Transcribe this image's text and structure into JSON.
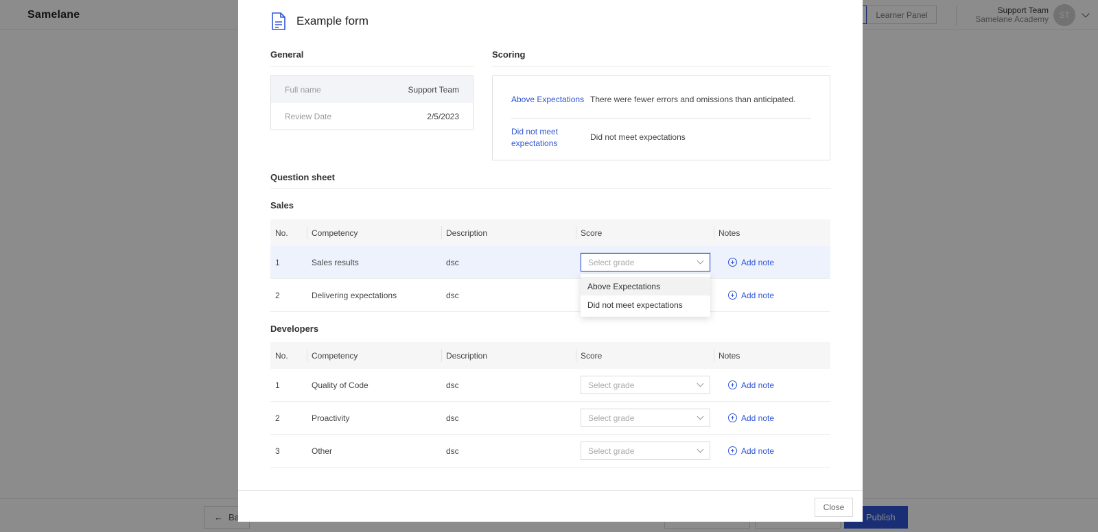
{
  "app": {
    "logo": "Samelane",
    "panel_active_fragment": "el",
    "panel_secondary": "Learner Panel",
    "user_name": "Support Team",
    "user_org": "Samelane Academy",
    "avatar_initials": "ST",
    "back_label": "Ba",
    "publish_label": "Publish"
  },
  "modal": {
    "title": "Example form",
    "general": {
      "title": "General",
      "rows": [
        {
          "label": "Full name",
          "value": "Support Team"
        },
        {
          "label": "Review Date",
          "value": "2/5/2023"
        }
      ]
    },
    "scoring": {
      "title": "Scoring",
      "items": [
        {
          "name": "Above Expectations",
          "description": "There were fewer errors and omissions than anticipated."
        },
        {
          "name": "Did not meet expectations",
          "description": "Did not meet expectations"
        }
      ]
    },
    "question_sheet_title": "Question sheet",
    "columns": {
      "no": "No.",
      "competency": "Competency",
      "description": "Description",
      "score": "Score",
      "notes": "Notes"
    },
    "select_placeholder": "Select grade",
    "add_note_label": "Add note",
    "sections": [
      {
        "title": "Sales",
        "rows": [
          {
            "no": "1",
            "competency": "Sales results",
            "description": "dsc"
          },
          {
            "no": "2",
            "competency": "Delivering expectations",
            "description": "dsc"
          }
        ]
      },
      {
        "title": "Developers",
        "rows": [
          {
            "no": "1",
            "competency": "Quality of Code",
            "description": "dsc"
          },
          {
            "no": "2",
            "competency": "Proactivity",
            "description": "dsc"
          },
          {
            "no": "3",
            "competency": "Other",
            "description": "dsc"
          }
        ]
      }
    ],
    "dropdown_options": [
      "Above Expectations",
      "Did not meet expectations"
    ],
    "close_label": "Close"
  },
  "colors": {
    "accent": "#2f55d4",
    "overlay": "rgba(0,0,0,0.45)"
  }
}
